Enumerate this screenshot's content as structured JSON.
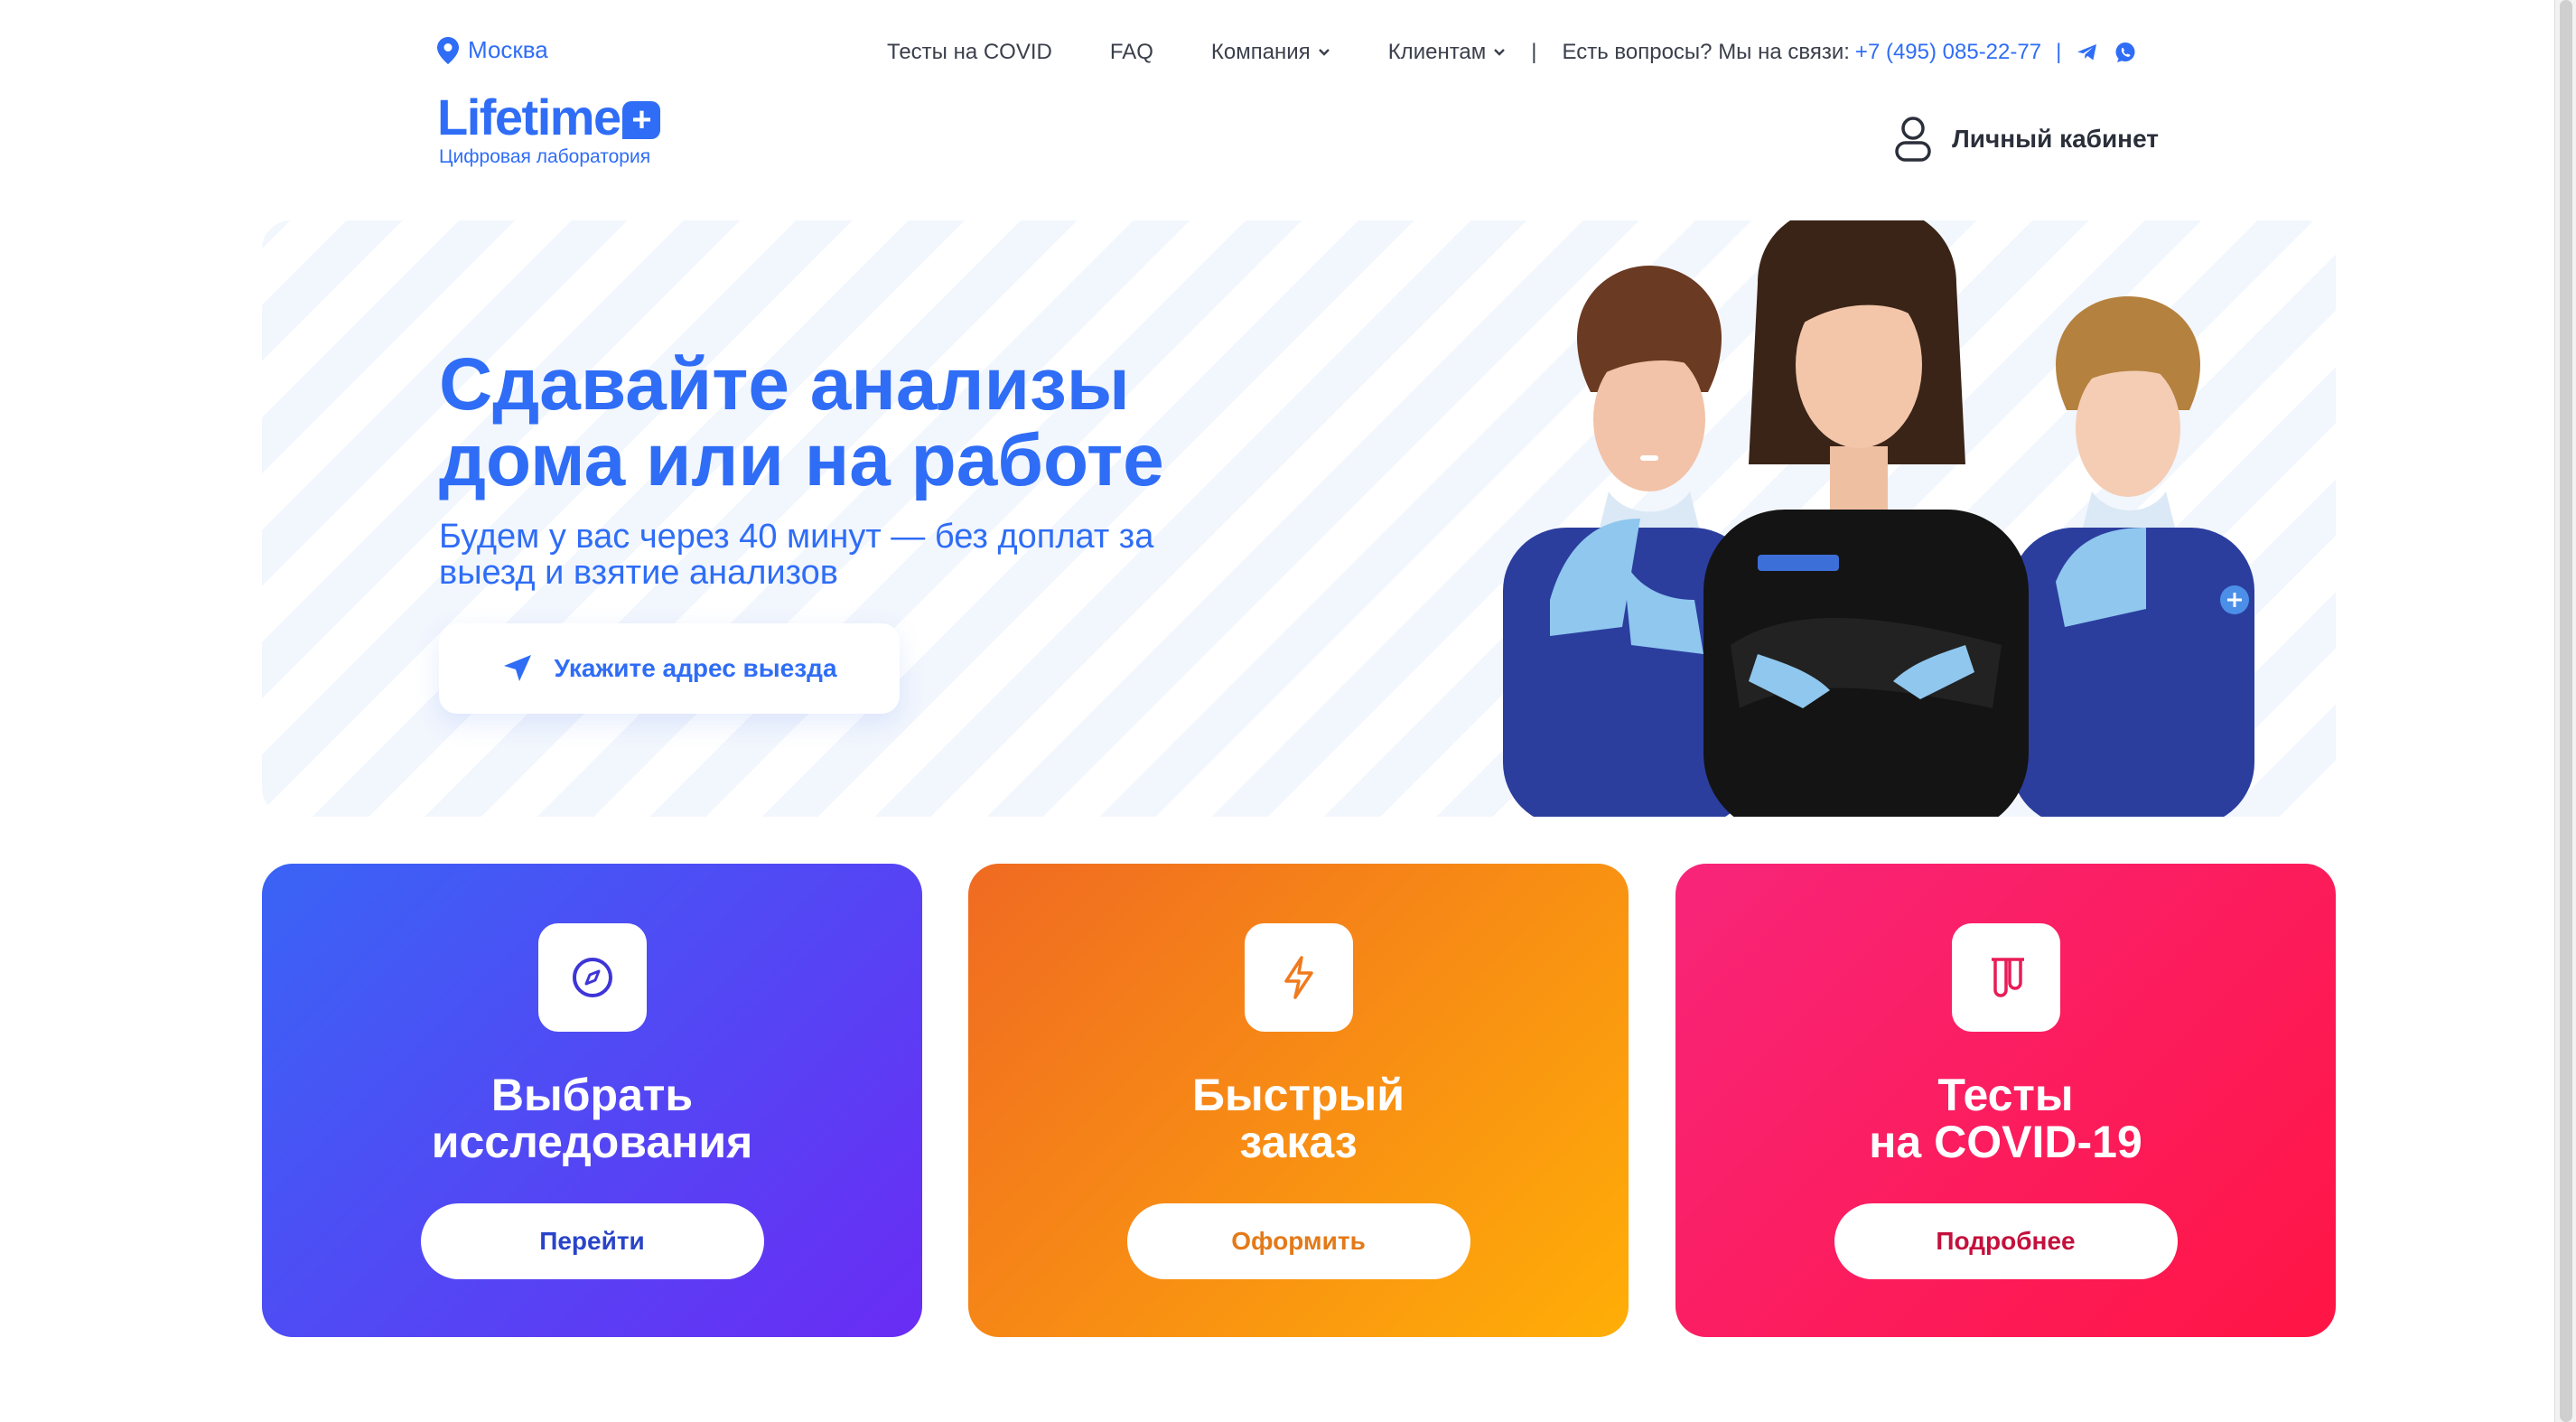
{
  "header": {
    "city": "Москва",
    "logo": {
      "word": "Lifetime",
      "plus": "+",
      "subtitle": "Цифровая лаборатория"
    },
    "nav": [
      {
        "label": "Тесты на COVID"
      },
      {
        "label": "FAQ"
      },
      {
        "label": "Компания"
      },
      {
        "label": "Клиентам"
      }
    ],
    "separator": "|",
    "contact_text": "Есть вопросы? Мы на связи:",
    "phone": "+7 (495) 085-22-77",
    "social": [
      "telegram-icon",
      "whatsapp-icon"
    ],
    "account_label": "Личный кабинет"
  },
  "hero": {
    "title": "Сдавайте анализы дома или на работе",
    "subtitle": "Будем у вас через 40 минут — без доплат за выезд и взятие анализов",
    "button_label": "Укажите адрес выезда",
    "accent_color": "#2f6df6"
  },
  "cards": [
    {
      "title": "Выбрать\nисследования",
      "button": "Перейти",
      "icon": "compass-icon",
      "colors": [
        "#3a64f5",
        "#6a2cf4"
      ]
    },
    {
      "title": "Быстрый\nзаказ",
      "button": "Оформить",
      "icon": "lightning-icon",
      "colors": [
        "#f06a22",
        "#ffae07"
      ]
    },
    {
      "title": "Тесты\nна COVID-19",
      "button": "Подробнее",
      "icon": "test-tubes-icon",
      "colors": [
        "#f8257a",
        "#ff1544"
      ]
    }
  ]
}
